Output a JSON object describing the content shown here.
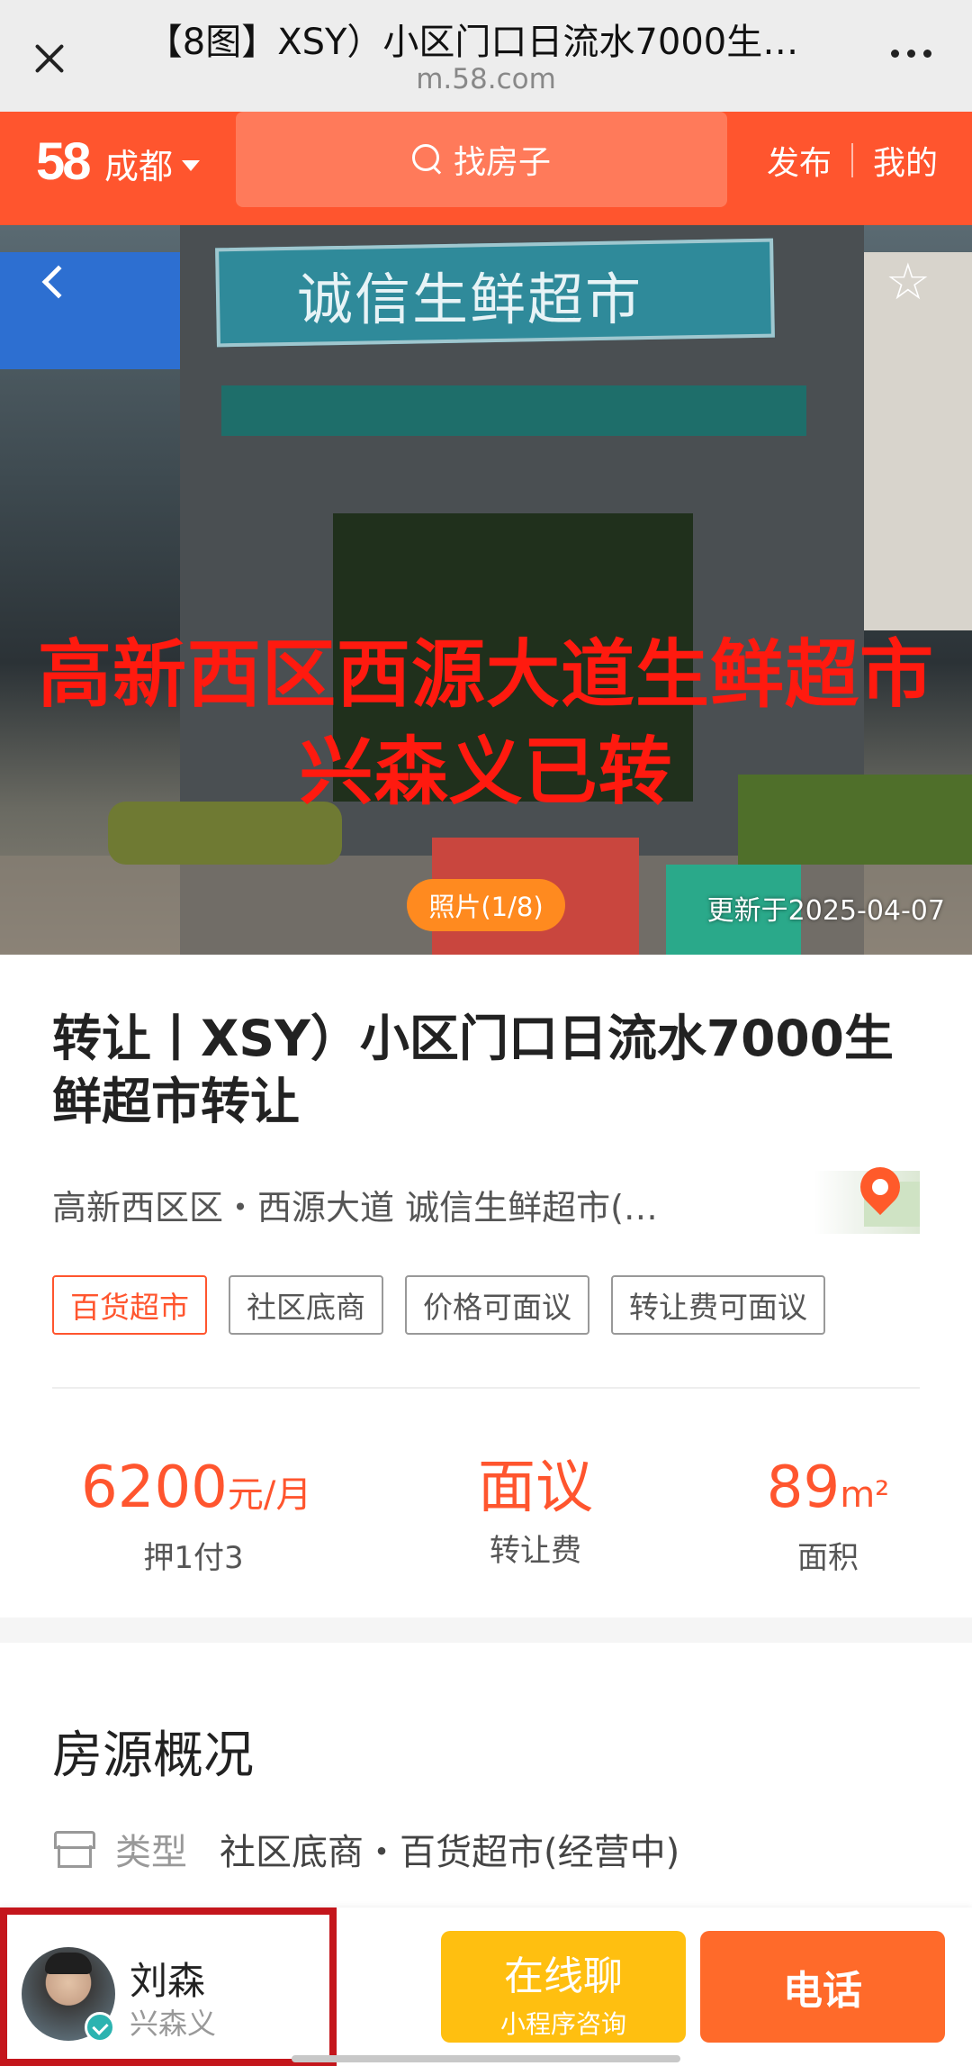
{
  "browser": {
    "page_title": "【8图】XSY）小区门口日流水7000生…",
    "domain": "m.58.com"
  },
  "nav": {
    "logo": "58",
    "city": "成都",
    "search_placeholder": "找房子",
    "publish": "发布",
    "mine": "我的"
  },
  "hero": {
    "sign_text": "诚信生鲜超市",
    "overlay_line1": "高新西区西源大道生鲜超市",
    "overlay_line2": "兴森义已转",
    "photo_counter": "照片(1/8)",
    "updated": "更新于2025-04-07"
  },
  "listing": {
    "title": "转让丨XSY）小区门口日流水7000生鲜超市转让",
    "address": "高新西区区・西源大道 诚信生鲜超市(…",
    "tags": [
      "百货超市",
      "社区底商",
      "价格可面议",
      "转让费可面议"
    ],
    "rent": {
      "value": "6200",
      "unit": "元/月",
      "label": "押1付3"
    },
    "fee": {
      "value": "面议",
      "label": "转让费"
    },
    "area": {
      "value": "89",
      "unit": "m²",
      "label": "面积"
    }
  },
  "overview": {
    "title": "房源概况",
    "type_key": "类型",
    "type_value": "社区底商・百货超市(经营中)"
  },
  "agent": {
    "name": "刘森",
    "company": "兴森义"
  },
  "actions": {
    "chat_main": "在线聊",
    "chat_sub": "小程序咨询",
    "call": "电话"
  },
  "colors": {
    "brand": "#ff552e",
    "chat": "#ffbf10",
    "call": "#ff6a2a",
    "highlight_box": "#c4161c"
  }
}
